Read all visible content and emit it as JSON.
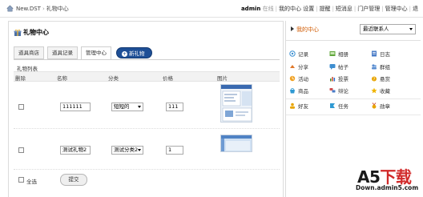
{
  "topbar": {
    "site_name": "New.DST",
    "separator": "›",
    "page": "礼物中心",
    "username": "admin",
    "online_status": "在线",
    "links": [
      "我的中心",
      "设置",
      "提醒",
      "短消息",
      "门户管理",
      "管理中心",
      "退"
    ]
  },
  "main": {
    "title": "礼物中心",
    "tabs": [
      {
        "label": "道具商店",
        "active": false
      },
      {
        "label": "道具记录",
        "active": false
      },
      {
        "label": "管理中心",
        "active": true
      }
    ],
    "new_gift_label": "新礼物",
    "section_title": "礼物列表",
    "columns": {
      "delete": "删除",
      "name": "名称",
      "category": "分类",
      "price": "价格",
      "image": "图片"
    },
    "rows": [
      {
        "name": "111111",
        "category": "短短的",
        "price": "111"
      },
      {
        "name": "测试礼物2",
        "category": "测试分类2",
        "price": "1"
      }
    ],
    "select_all_label": "全选",
    "submit_label": "提交"
  },
  "sidebar": {
    "title": "我的中心",
    "recent_contacts": "最近联系人",
    "apps": [
      [
        {
          "label": "记录",
          "icon": "record-icon"
        },
        {
          "label": "相册",
          "icon": "album-icon"
        },
        {
          "label": "日志",
          "icon": "blog-icon"
        }
      ],
      [
        {
          "label": "分享",
          "icon": "share-icon"
        },
        {
          "label": "帖子",
          "icon": "post-icon"
        },
        {
          "label": "群组",
          "icon": "group-icon"
        }
      ],
      [
        {
          "label": "活动",
          "icon": "activity-icon"
        },
        {
          "label": "投票",
          "icon": "poll-icon"
        },
        {
          "label": "悬赏",
          "icon": "reward-icon"
        }
      ],
      [
        {
          "label": "商品",
          "icon": "goods-icon"
        },
        {
          "label": "辩论",
          "icon": "debate-icon"
        },
        {
          "label": "收藏",
          "icon": "favorite-icon"
        }
      ],
      [
        {
          "label": "好友",
          "icon": "friends-icon"
        },
        {
          "label": "任务",
          "icon": "task-icon"
        },
        {
          "label": "勋章",
          "icon": "medal-icon"
        }
      ]
    ]
  },
  "watermark": {
    "brand_prefix": "A5",
    "brand_suffix": "下载",
    "url": "Down.admin5.com"
  },
  "colors": {
    "accent_blue": "#1e4f96",
    "my_center_orange": "#d05a00",
    "watermark_red": "#d12a2a"
  }
}
